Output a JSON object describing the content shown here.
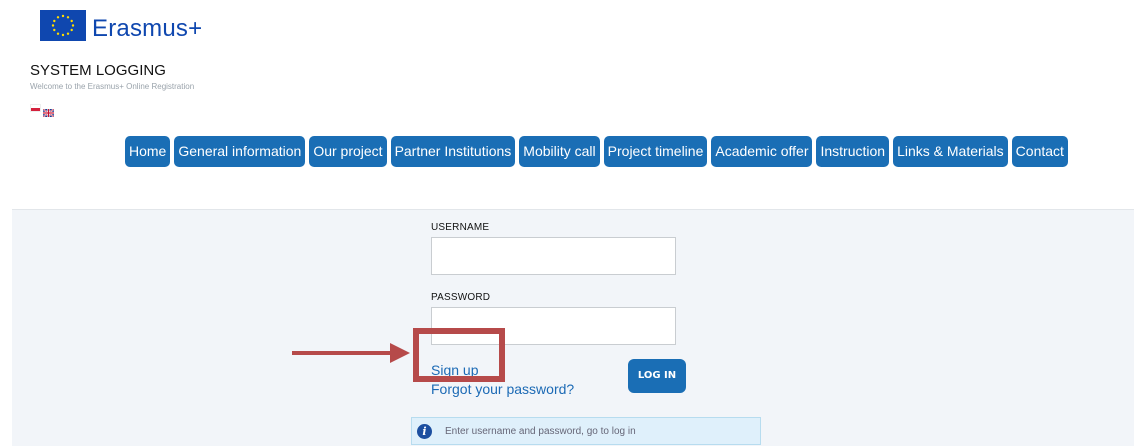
{
  "logo": {
    "text": "Erasmus+",
    "icon": "eu-flag-icon"
  },
  "header": {
    "title": "SYSTEM LOGGING",
    "subtitle": "Welcome to the Erasmus+ Online Registration"
  },
  "languages": [
    {
      "name": "polish-flag-icon"
    },
    {
      "name": "uk-flag-icon"
    }
  ],
  "nav": {
    "items": [
      {
        "label": "Home"
      },
      {
        "label": "General information"
      },
      {
        "label": "Our project"
      },
      {
        "label": "Partner Institutions"
      },
      {
        "label": "Mobility call"
      },
      {
        "label": "Project timeline"
      },
      {
        "label": "Academic offer"
      },
      {
        "label": "Instruction"
      },
      {
        "label": "Links & Materials"
      },
      {
        "label": "Contact"
      }
    ]
  },
  "login": {
    "username_label": "USERNAME",
    "username_value": "",
    "password_label": "PASSWORD",
    "password_value": "",
    "signup_label": "Sign up",
    "forgot_label": "Forgot your password?",
    "login_button": "LOG IN",
    "info_text": "Enter username and password, go to log in"
  },
  "colors": {
    "primary": "#1a6eb5",
    "brand": "#0f47af",
    "panel_bg": "#f2f5f9",
    "annotation": "#b64a4a"
  }
}
